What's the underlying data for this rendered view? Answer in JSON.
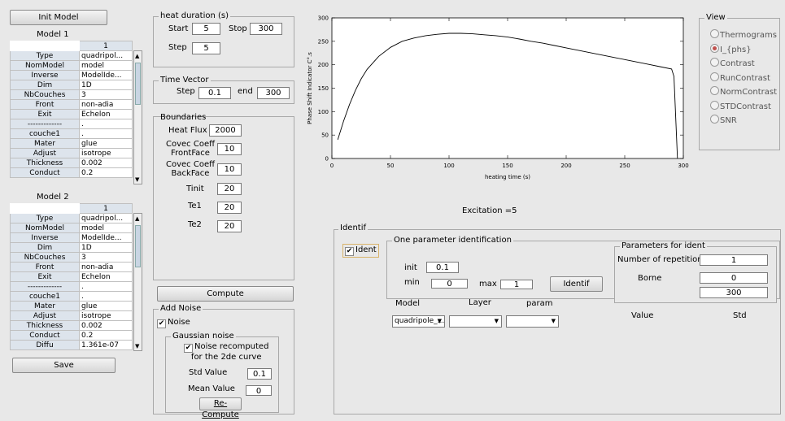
{
  "left": {
    "init_model": "Init Model",
    "model1_title": "Model 1",
    "model2_title": "Model 2",
    "col_header": "1",
    "model1_rows": [
      {
        "k": "Type",
        "v": "quadripol..."
      },
      {
        "k": "NomModel",
        "v": "model"
      },
      {
        "k": "Inverse",
        "v": "ModelIde..."
      },
      {
        "k": "Dim",
        "v": "1D"
      },
      {
        "k": "NbCouches",
        "v": "3"
      },
      {
        "k": "Front",
        "v": "non-adia"
      },
      {
        "k": "Exit",
        "v": "Echelon"
      },
      {
        "k": "-------------",
        "v": "."
      },
      {
        "k": "couche1",
        "v": "."
      },
      {
        "k": "Mater",
        "v": "glue"
      },
      {
        "k": "Adjust",
        "v": "isotrope"
      },
      {
        "k": "Thickness",
        "v": "0.002"
      },
      {
        "k": "Conduct",
        "v": "0.2"
      }
    ],
    "model2_rows": [
      {
        "k": "Type",
        "v": "quadripol..."
      },
      {
        "k": "NomModel",
        "v": "model"
      },
      {
        "k": "Inverse",
        "v": "ModelIde..."
      },
      {
        "k": "Dim",
        "v": "1D"
      },
      {
        "k": "NbCouches",
        "v": "3"
      },
      {
        "k": "Front",
        "v": "non-adia"
      },
      {
        "k": "Exit",
        "v": "Echelon"
      },
      {
        "k": "-------------",
        "v": "."
      },
      {
        "k": "couche1",
        "v": "."
      },
      {
        "k": "Mater",
        "v": "glue"
      },
      {
        "k": "Adjust",
        "v": "isotrope"
      },
      {
        "k": "Thickness",
        "v": "0.002"
      },
      {
        "k": "Conduct",
        "v": "0.2"
      },
      {
        "k": "Diffu",
        "v": "1.361e-07"
      }
    ],
    "save": "Save"
  },
  "heat": {
    "title": "heat duration (s)",
    "start_label": "Start",
    "start": "5",
    "stop_label": "Stop",
    "stop": "300",
    "step_label": "Step",
    "step": "5"
  },
  "timevec": {
    "title": "Time Vector",
    "step_label": "Step",
    "step": "0.1",
    "end_label": "end",
    "end": "300"
  },
  "boundaries": {
    "title": "Boundaries",
    "heatflux_label": "Heat Flux",
    "heatflux": "2000",
    "covec_front_label1": "Covec Coeff",
    "covec_front_label2": "FrontFace",
    "covec_front": "10",
    "covec_back_label1": "Covec Coeff",
    "covec_back_label2": "BackFace",
    "covec_back": "10",
    "tinit_label": "Tinit",
    "tinit": "20",
    "te1_label": "Te1",
    "te1": "20",
    "te2_label": "Te2",
    "te2": "20"
  },
  "compute": "Compute",
  "noise": {
    "title": "Add Noise",
    "noise_label": "Noise",
    "gaussian_title": "Gaussian noise",
    "recomputed_line1": "Noise recomputed",
    "recomputed_line2": "for the 2de curve",
    "std_label": "Std Value",
    "std": "0.1",
    "mean_label": "Mean Value",
    "mean": "0",
    "recompute": "Re-Compute"
  },
  "chart_data": {
    "type": "line",
    "ylabel": "Phase Shift Indicator C°.s",
    "xlabel": "heating time (s)",
    "xlim": [
      0,
      300
    ],
    "ylim": [
      0,
      300
    ],
    "xticks": [
      0,
      50,
      100,
      150,
      200,
      250,
      300
    ],
    "yticks": [
      0,
      50,
      100,
      150,
      200,
      250,
      300
    ],
    "x": [
      5,
      10,
      15,
      20,
      25,
      30,
      40,
      50,
      60,
      70,
      80,
      90,
      100,
      110,
      120,
      130,
      140,
      150,
      160,
      170,
      180,
      190,
      200,
      210,
      220,
      230,
      240,
      250,
      260,
      270,
      280,
      290,
      292,
      295
    ],
    "y": [
      40,
      80,
      115,
      145,
      170,
      190,
      218,
      237,
      250,
      257,
      262,
      265,
      267,
      267,
      266,
      264,
      262,
      259,
      255,
      250,
      246,
      241,
      236,
      231,
      226,
      221,
      216,
      211,
      206,
      201,
      196,
      191,
      175,
      0
    ]
  },
  "excitation": "Excitation =5",
  "view": {
    "title": "View",
    "options": [
      "Thermograms",
      "I_{phs}",
      "Contrast",
      "RunContrast",
      "NormContrast",
      "STDContrast",
      "SNR"
    ],
    "selected": "I_{phs}",
    "selected_color": "#c0504d"
  },
  "identif": {
    "title": "Identif",
    "ident_label": "Ident",
    "one_param_title": "One parameter identification",
    "init_label": "init",
    "init": "0.1",
    "min_label": "min",
    "min": "0",
    "max_label": "max",
    "max": "1",
    "identif_button": "Identif",
    "model_label": "Model",
    "layer_label": "Layer",
    "param_label": "param",
    "model_value": "quadripole_...",
    "params_title": "Parameters for ident",
    "nrep_label": "Number of repetition",
    "nrep": "1",
    "borne_label": "Borne",
    "borne_min": "0",
    "borne_max": "300",
    "value_label": "Value",
    "std_label": "Std"
  }
}
